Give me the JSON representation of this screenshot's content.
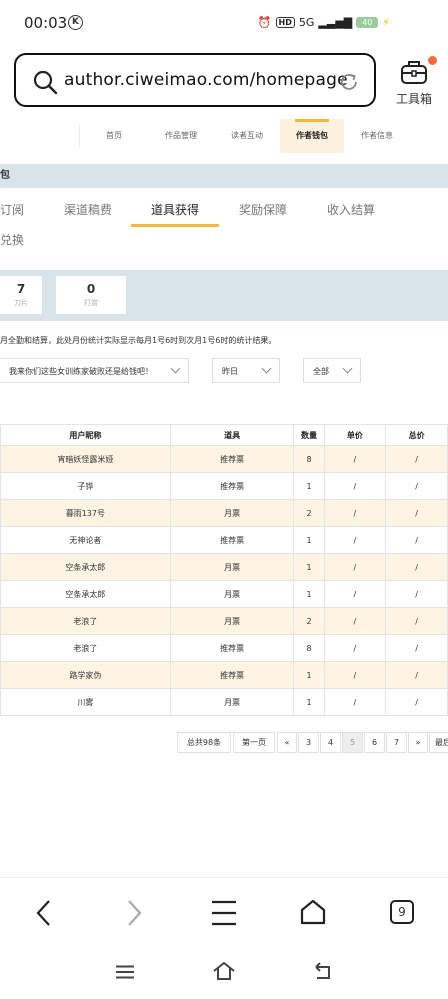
{
  "status": {
    "time": "00:03",
    "k_badge": "K",
    "hd": "HD",
    "signal": "5G",
    "battery": "40",
    "charging": "⚡"
  },
  "browser": {
    "url": "author.ciweimao.com/homepage",
    "toolbox_label": "工具箱"
  },
  "nav_tabs": [
    "首页",
    "作品管理",
    "读者互动",
    "作者钱包",
    "作者信息"
  ],
  "section_title": "包",
  "sub_tabs_row1": [
    "订阅",
    "渠道稿费",
    "道具获得",
    "奖励保障",
    "收入结算"
  ],
  "sub_tabs_row2": [
    "兑换"
  ],
  "stats": [
    {
      "value": "7",
      "label": "刀片"
    },
    {
      "value": "0",
      "label": "打赏"
    }
  ],
  "notice": "月全勤和结算，此处月份统计实际显示每月1号6时到次月1号6时的统计结果。",
  "filters": {
    "book": "我来你们这些女训练家破败还是给钱吧！",
    "date": "昨日",
    "type": "全部"
  },
  "table": {
    "headers": [
      "用户昵称",
      "道具",
      "数量",
      "单价",
      "总价"
    ],
    "rows": [
      [
        "宵暗妖怪露米娅",
        "推荐票",
        "8",
        "/",
        "/"
      ],
      [
        "子铧",
        "推荐票",
        "1",
        "/",
        "/"
      ],
      [
        "暮雨137号",
        "月票",
        "2",
        "/",
        "/"
      ],
      [
        "无神论者",
        "推荐票",
        "1",
        "/",
        "/"
      ],
      [
        "空条承太郎",
        "月票",
        "1",
        "/",
        "/"
      ],
      [
        "空条承太郎",
        "月票",
        "1",
        "/",
        "/"
      ],
      [
        "老浪了",
        "月票",
        "2",
        "/",
        "/"
      ],
      [
        "老浪了",
        "推荐票",
        "8",
        "/",
        "/"
      ],
      [
        "路学家伪",
        "推荐票",
        "1",
        "/",
        "/"
      ],
      [
        "川雾",
        "月票",
        "1",
        "/",
        "/"
      ]
    ]
  },
  "pagination": {
    "total": "总共98条",
    "first": "第一页",
    "prev": "«",
    "pages": [
      "3",
      "4",
      "5",
      "6",
      "7"
    ],
    "current": "5",
    "next": "»",
    "last": "最后"
  },
  "bottom_nav": {
    "tabs_count": "9"
  },
  "colors": {
    "accent": "#f0b83c",
    "band": "#d9e4ea",
    "row_highlight": "#fdf4e4",
    "notify_dot": "#f26b3a"
  }
}
